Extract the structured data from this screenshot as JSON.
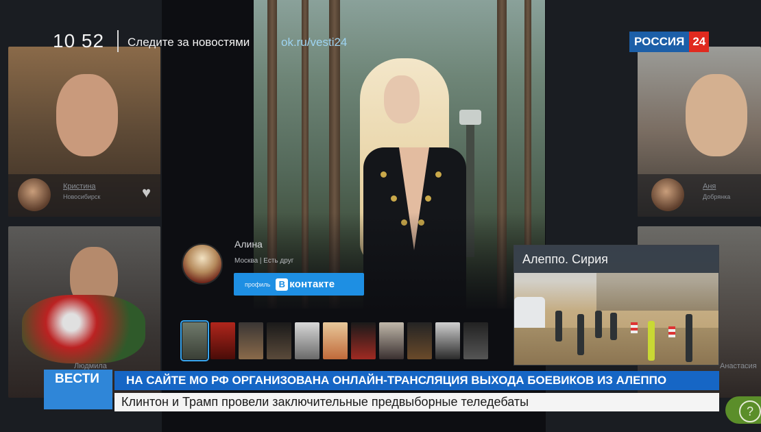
{
  "broadcast": {
    "clock": "10 52",
    "follow_text": "Следите за новостями",
    "follow_link": "ok.ru/vesti24",
    "channel_logo": {
      "text": "РОССИЯ",
      "number": "24",
      "colors": {
        "blue": "#1c5fa8",
        "red": "#e02a1f"
      }
    }
  },
  "profile": {
    "name": "Алина",
    "details": "Москва | Есть друг",
    "button_label": "профиль",
    "button_brand": "контакте",
    "button_logo": "В",
    "accent": "#1e8fe3"
  },
  "background_tiles": [
    {
      "name": "Кристина",
      "city": "Новосибирск"
    },
    {
      "name": "Аня",
      "city": "Добрянка"
    },
    {
      "name": "Людмила",
      "city": ""
    },
    {
      "name": "Анастасия",
      "city": ""
    }
  ],
  "inset": {
    "title": "Алеппо. Сирия"
  },
  "lower_third": {
    "program": "ВЕСТИ",
    "breaking": "НА САЙТЕ МО РФ ОРГАНИЗОВАНА ОНЛАЙН-ТРАНСЛЯЦИЯ ВЫХОДА БОЕВИКОВ ИЗ АЛЕППО",
    "news": "Клинтон и Трамп провели заключительные предвыборные теледебаты"
  },
  "help": {
    "icon": "?"
  }
}
